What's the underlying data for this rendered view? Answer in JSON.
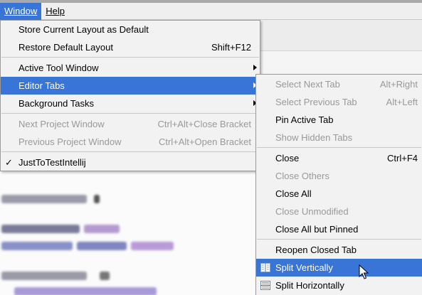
{
  "menubar": {
    "window_label": "Window",
    "help_label": "Help"
  },
  "window_menu": {
    "items": [
      {
        "label": "Store Current Layout as Default",
        "shortcut": "",
        "state": "enabled"
      },
      {
        "label": "Restore Default Layout",
        "shortcut": "Shift+F12",
        "state": "enabled"
      },
      {
        "label": "Active Tool Window",
        "shortcut": "",
        "state": "enabled"
      },
      {
        "label": "Editor Tabs",
        "shortcut": "",
        "state": "selected"
      },
      {
        "label": "Background Tasks",
        "shortcut": "",
        "state": "enabled"
      },
      {
        "label": "Next Project Window",
        "shortcut": "Ctrl+Alt+Close Bracket",
        "state": "disabled"
      },
      {
        "label": "Previous Project Window",
        "shortcut": "Ctrl+Alt+Open Bracket",
        "state": "disabled"
      },
      {
        "label": "JustToTestIntellij",
        "shortcut": "",
        "state": "checked"
      }
    ],
    "check_mark": "✓"
  },
  "editor_tabs_menu": {
    "items": [
      {
        "label": "Select Next Tab",
        "shortcut": "Alt+Right",
        "state": "disabled"
      },
      {
        "label": "Select Previous Tab",
        "shortcut": "Alt+Left",
        "state": "disabled"
      },
      {
        "label": "Pin Active Tab",
        "shortcut": "",
        "state": "enabled"
      },
      {
        "label": "Show Hidden Tabs",
        "shortcut": "",
        "state": "disabled"
      },
      {
        "label": "Close",
        "shortcut": "Ctrl+F4",
        "state": "enabled"
      },
      {
        "label": "Close Others",
        "shortcut": "",
        "state": "disabled"
      },
      {
        "label": "Close All",
        "shortcut": "",
        "state": "enabled"
      },
      {
        "label": "Close Unmodified",
        "shortcut": "",
        "state": "disabled"
      },
      {
        "label": "Close All but Pinned",
        "shortcut": "",
        "state": "enabled"
      },
      {
        "label": "Reopen Closed Tab",
        "shortcut": "",
        "state": "enabled"
      },
      {
        "label": "Split Vertically",
        "shortcut": "",
        "state": "selected",
        "icon": "split-vertically-icon"
      },
      {
        "label": "Split Horizontally",
        "shortcut": "",
        "state": "enabled",
        "icon": "split-horizontally-icon"
      }
    ]
  },
  "colors": {
    "selection": "#3875d7",
    "menu_bg": "#f2f2f2",
    "disabled_text": "#999999"
  }
}
